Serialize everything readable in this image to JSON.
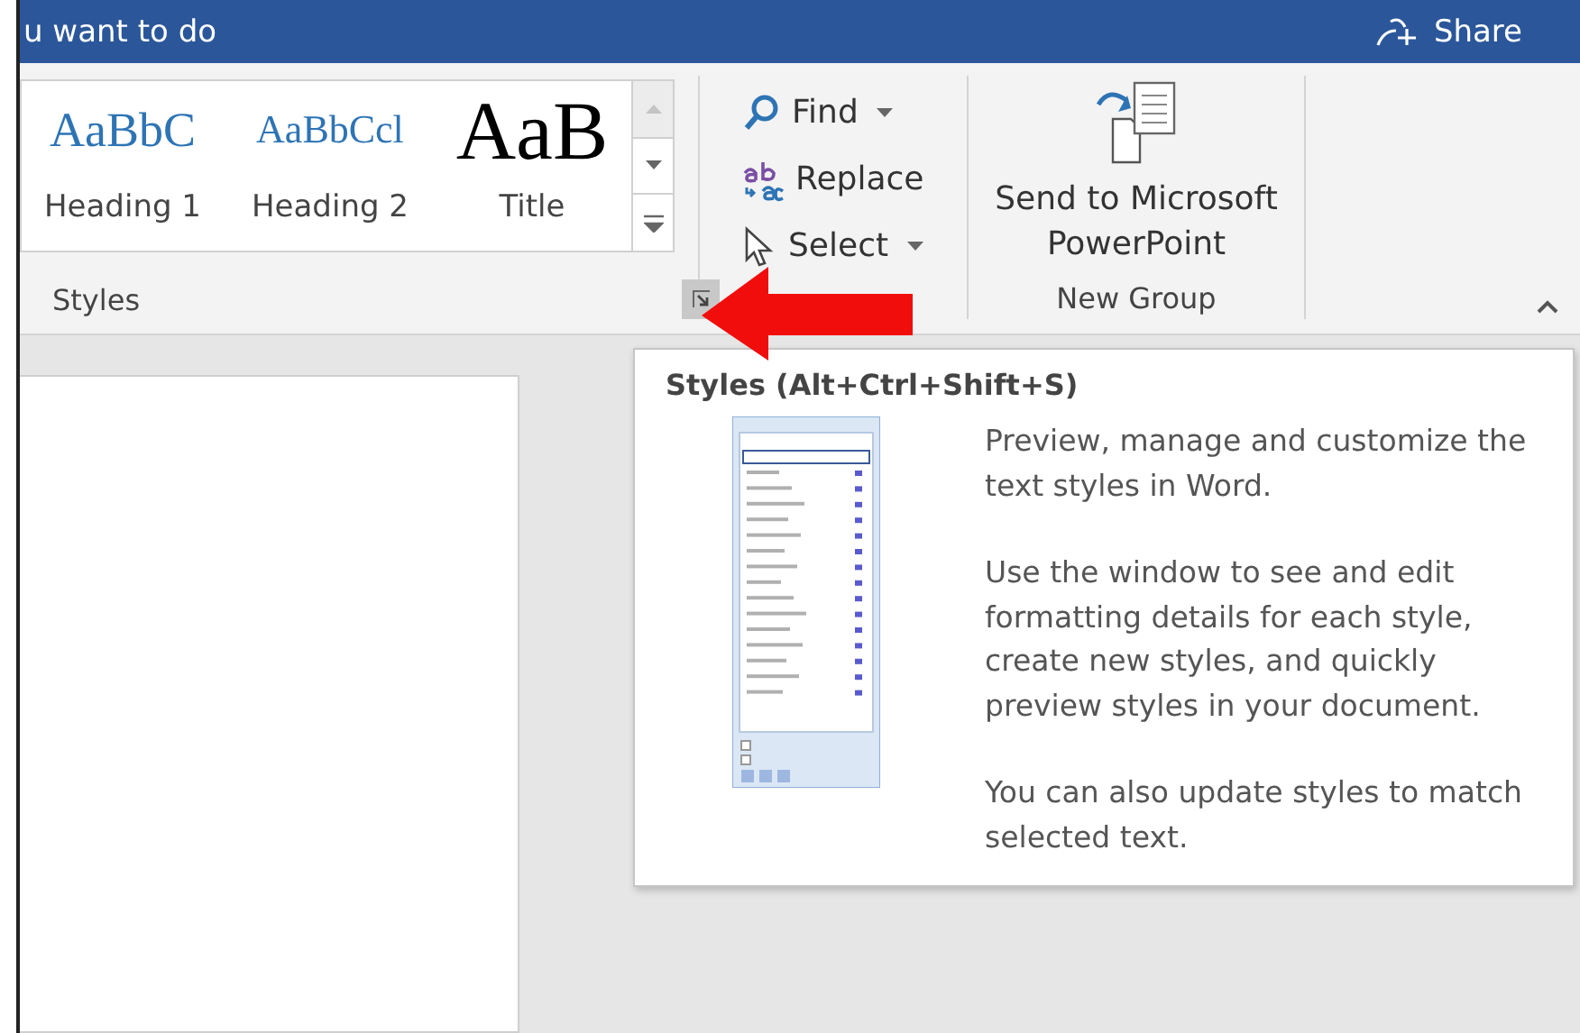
{
  "title_bar": {
    "search_text": "u want to do",
    "share": "Share"
  },
  "styles_group": {
    "label": "Styles",
    "styles": [
      {
        "preview": "AaBbC",
        "name": "Heading 1",
        "kind": "heading1"
      },
      {
        "preview": "AaBbCcl",
        "name": "Heading 2",
        "kind": "heading2"
      },
      {
        "preview": "AaB",
        "name": "Title",
        "kind": "title"
      }
    ]
  },
  "editing_group": {
    "buttons": [
      {
        "label": "Find",
        "kind": "find",
        "dropdown": true
      },
      {
        "label": "Replace",
        "kind": "replace",
        "dropdown": false
      },
      {
        "label": "Select",
        "kind": "select",
        "dropdown": true
      }
    ]
  },
  "new_group": {
    "button": "Send to Microsoft PowerPoint",
    "label": "New Group"
  },
  "tooltip": {
    "title": "Styles (Alt+Ctrl+Shift+S)",
    "paragraphs": [
      "Preview, manage and customize the text styles in Word.",
      "Use the window to see and edit formatting details for each style, create new styles, and quickly preview styles in your document.",
      "You can also update styles to match selected text."
    ]
  }
}
